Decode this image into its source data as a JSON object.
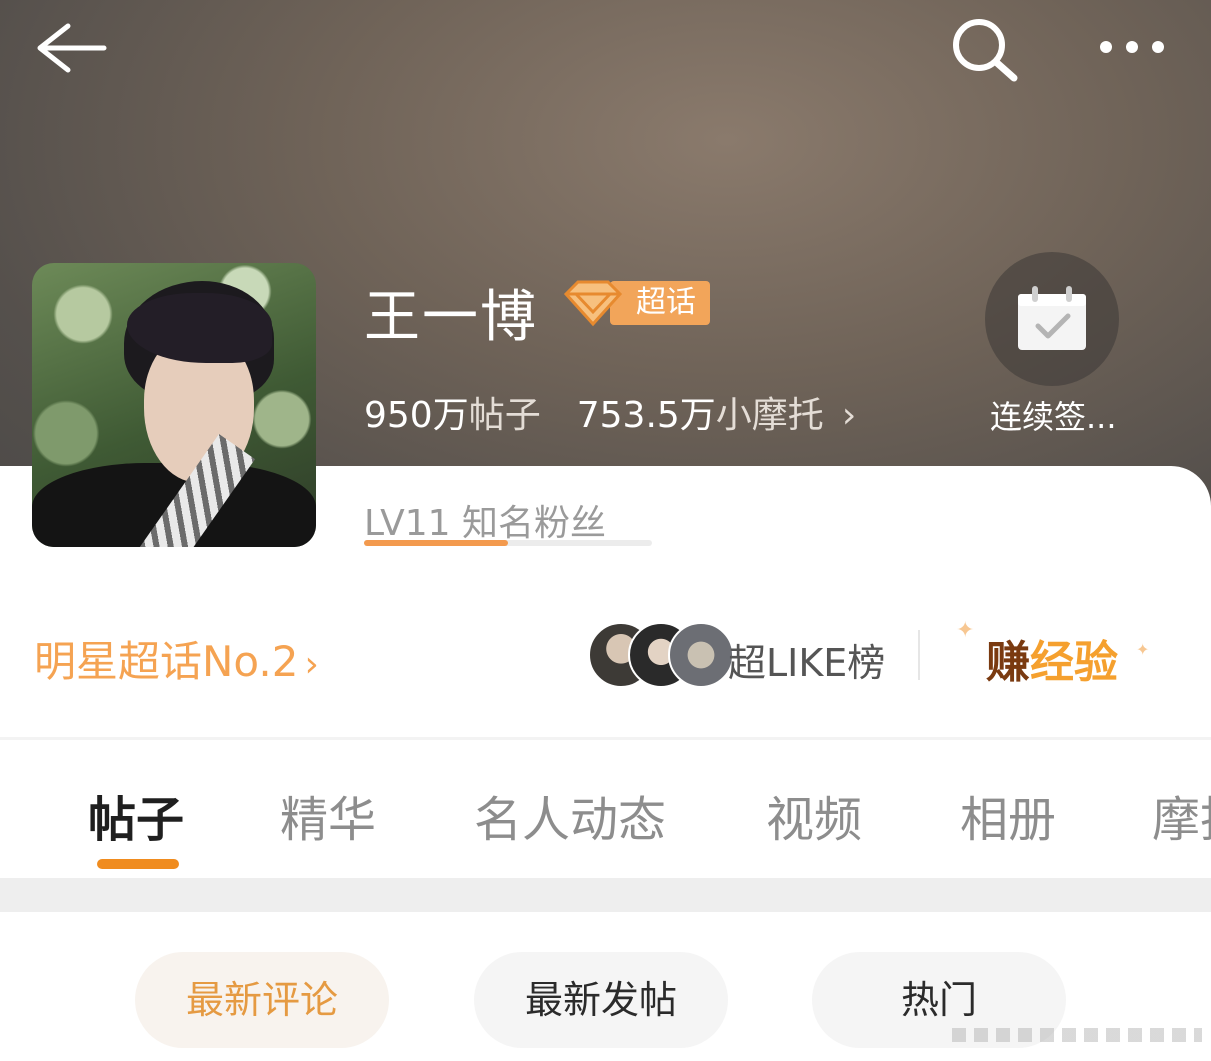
{
  "header": {
    "back_icon": "arrow-left-icon",
    "search_icon": "search-icon",
    "more_icon": "more-dots-icon"
  },
  "profile": {
    "name": "王一博",
    "badge_label": "超话",
    "badge_icon": "diamond-icon",
    "stats": {
      "posts_value": "950万",
      "posts_label": "帖子",
      "followers_value": "753.5万",
      "followers_label": "小摩托"
    },
    "checkin_label": "连续签...",
    "level_text": "LV11 知名粉丝",
    "level_progress": 0.5
  },
  "rank": {
    "label": "明星超话No.2",
    "like_label": "超LIKE榜",
    "earn_part1": "赚",
    "earn_part2": "经验"
  },
  "tabs": [
    {
      "label": "帖子",
      "active": true
    },
    {
      "label": "精华"
    },
    {
      "label": "名人动态"
    },
    {
      "label": "视频"
    },
    {
      "label": "相册"
    },
    {
      "label": "摩托"
    }
  ],
  "sort_buttons": [
    {
      "label": "最新评论",
      "active": true
    },
    {
      "label": "最新发帖"
    },
    {
      "label": "热门"
    }
  ],
  "colors": {
    "accent": "#f08c1f",
    "badge": "#f2a55a"
  }
}
